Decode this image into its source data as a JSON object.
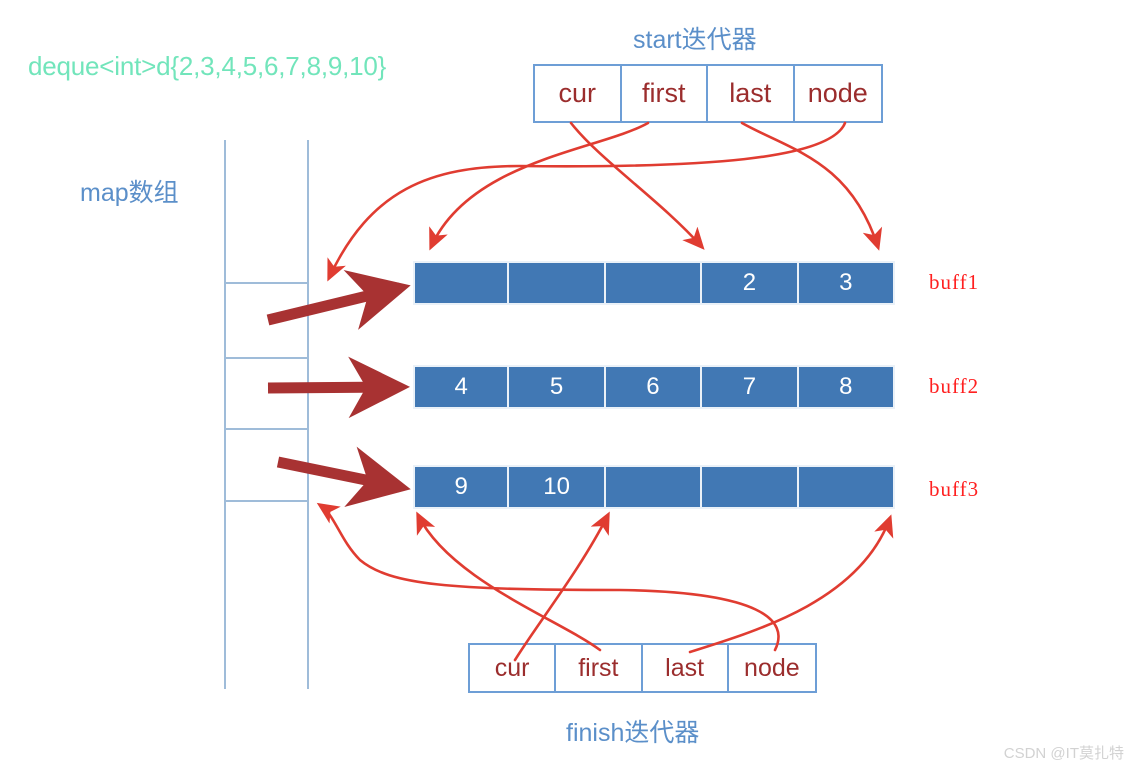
{
  "diagram": {
    "title": "deque<int>d{2,3,4,5,6,7,8,9,10}",
    "map_label": "map数组",
    "start_label": "start迭代器",
    "finish_label": "finish迭代器",
    "watermark": "CSDN @IT莫扎特"
  },
  "colors": {
    "title_green": "#72e5bb",
    "label_blue": "#5b8fc9",
    "box_border_blue": "#6d9ed6",
    "iter_text_red": "#9b2d2d",
    "buffer_blue": "#4178b4",
    "buffer_text": "#ffffff",
    "buff_label_red": "#ff2020",
    "arrow_red": "#e03c31",
    "arrow_dark_red": "#a83232",
    "map_line_blue": "#9fbcd9"
  },
  "start_iterator": {
    "label": "start迭代器",
    "fields": [
      {
        "name": "cur"
      },
      {
        "name": "first"
      },
      {
        "name": "last"
      },
      {
        "name": "node"
      }
    ]
  },
  "finish_iterator": {
    "label": "finish迭代器",
    "fields": [
      {
        "name": "cur"
      },
      {
        "name": "first"
      },
      {
        "name": "last"
      },
      {
        "name": "node"
      }
    ]
  },
  "map_array": {
    "label": "map数组",
    "cell_count": 8,
    "occupied_indices": [
      2,
      3,
      4
    ]
  },
  "buffers": [
    {
      "label": "buff1",
      "cells": [
        "",
        "",
        "",
        "2",
        "3"
      ]
    },
    {
      "label": "buff2",
      "cells": [
        "4",
        "5",
        "6",
        "7",
        "8"
      ]
    },
    {
      "label": "buff3",
      "cells": [
        "9",
        "10",
        "",
        "",
        ""
      ]
    }
  ],
  "pointers": {
    "start": [
      {
        "from": "cur",
        "to": "buff1 cell index 3 (value 2)"
      },
      {
        "from": "first",
        "to": "buff1 cell index 0"
      },
      {
        "from": "last",
        "to": "buff1 end (right edge)"
      },
      {
        "from": "node",
        "to": "map array slot of buff1"
      }
    ],
    "finish": [
      {
        "from": "cur",
        "to": "buff3 cell index 2 (first empty)"
      },
      {
        "from": "first",
        "to": "buff3 cell index 0 (value 9)"
      },
      {
        "from": "last",
        "to": "buff3 end (right edge)"
      },
      {
        "from": "node",
        "to": "map array slot of buff3"
      }
    ]
  }
}
